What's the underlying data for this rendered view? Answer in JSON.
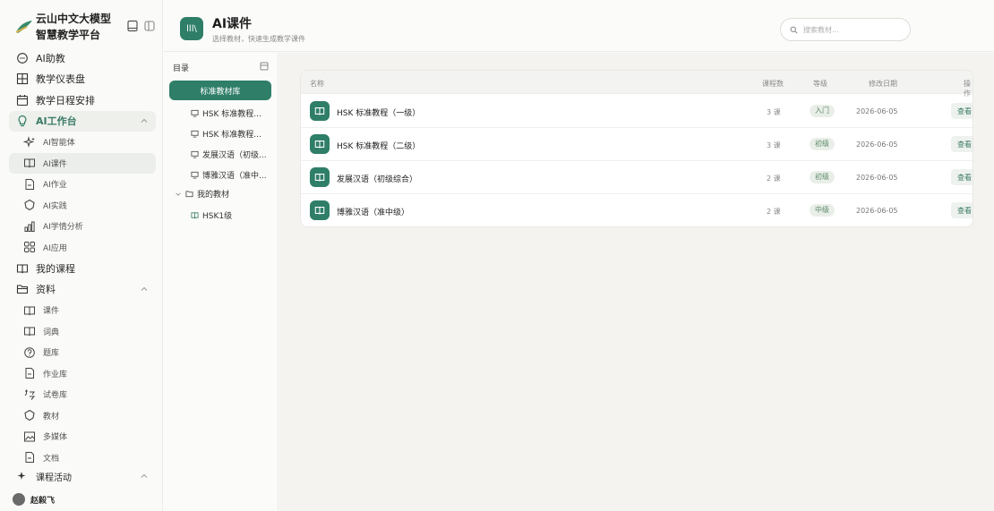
{
  "brand": {
    "line1": "云山中文大模型",
    "line2": "智慧教学平台"
  },
  "sidebar": {
    "items": [
      {
        "label": "AI助教",
        "icon": "chat-bubble-icon",
        "level": "top"
      },
      {
        "label": "教学仪表盘",
        "icon": "grid-icon",
        "level": "top"
      },
      {
        "label": "教学日程安排",
        "icon": "calendar-icon",
        "level": "top"
      },
      {
        "label": "AI工作台",
        "icon": "bulb-icon",
        "level": "top",
        "expanded": true
      },
      {
        "label": "AI智能体",
        "icon": "sparkle-icon",
        "level": "sub"
      },
      {
        "label": "AI课件",
        "icon": "book-icon",
        "level": "sub",
        "active": true
      },
      {
        "label": "AI作业",
        "icon": "document-icon",
        "level": "sub"
      },
      {
        "label": "AI实践",
        "icon": "hexagon-icon",
        "level": "sub"
      },
      {
        "label": "AI学情分析",
        "icon": "bar-chart-icon",
        "level": "sub"
      },
      {
        "label": "AI应用",
        "icon": "apps-icon",
        "level": "sub"
      },
      {
        "label": "我的课程",
        "icon": "book-icon",
        "level": "top"
      },
      {
        "label": "资料",
        "icon": "folder-icon",
        "level": "top",
        "expanded": true
      },
      {
        "label": "课件",
        "icon": "book-icon",
        "level": "sub"
      },
      {
        "label": "词典",
        "icon": "book-icon",
        "level": "sub"
      },
      {
        "label": "题库",
        "icon": "question-icon",
        "level": "sub"
      },
      {
        "label": "作业库",
        "icon": "document-icon",
        "level": "sub"
      },
      {
        "label": "试卷库",
        "icon": "exam-icon",
        "level": "sub"
      },
      {
        "label": "教材",
        "icon": "hexagon-icon",
        "level": "sub"
      },
      {
        "label": "多媒体",
        "icon": "image-icon",
        "level": "sub"
      },
      {
        "label": "文档",
        "icon": "document-icon",
        "level": "sub"
      },
      {
        "label": "课程活动",
        "icon": "sparkle-icon",
        "level": "top",
        "expanded": true
      }
    ],
    "user": "赵毅飞"
  },
  "header": {
    "icon_label": "lll\\",
    "title": "AI课件",
    "subtitle": "选择教材，快速生成教学课件",
    "search_placeholder": "搜索教材..."
  },
  "directory": {
    "heading": "目录",
    "library": "标准教材库",
    "books": [
      "HSK 标准教程...",
      "HSK 标准教程...",
      "发展汉语（初级...",
      "博雅汉语（准中..."
    ],
    "my_group": "我的教材",
    "my_books": [
      "HSK1级"
    ]
  },
  "table": {
    "columns": [
      "名称",
      "课程数",
      "等级",
      "修改日期",
      "操作"
    ],
    "rows": [
      {
        "name": "HSK 标准教程（一级）",
        "count": "3 课",
        "level": "入门",
        "date": "2026-06-05",
        "action": "查看"
      },
      {
        "name": "HSK 标准教程（二级）",
        "count": "3 课",
        "level": "初级",
        "date": "2026-06-05",
        "action": "查看"
      },
      {
        "name": "发展汉语（初级综合）",
        "count": "2 课",
        "level": "初级",
        "date": "2026-06-05",
        "action": "查看"
      },
      {
        "name": "博雅汉语（准中级）",
        "count": "2 课",
        "level": "中级",
        "date": "2026-06-05",
        "action": "查看"
      }
    ]
  },
  "colors": {
    "accent": "#2f7e68",
    "background": "#f5f3ef",
    "badge_bg": "#e9efe8"
  }
}
